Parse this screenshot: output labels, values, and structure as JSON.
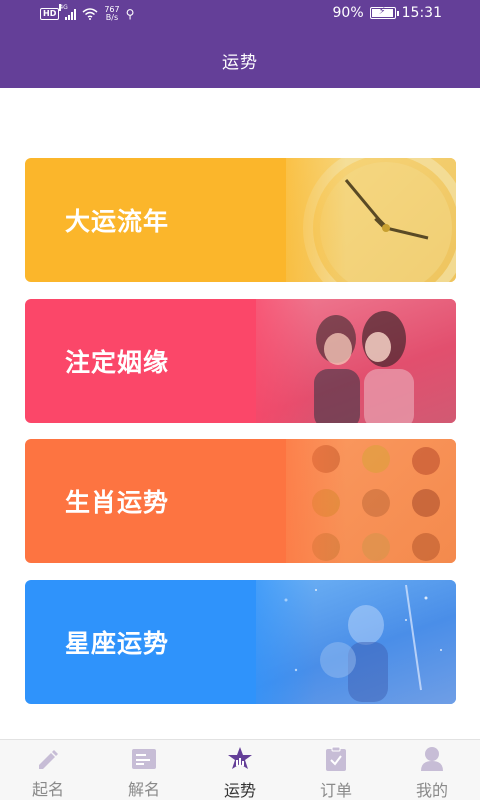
{
  "status_bar": {
    "hd": "HD",
    "network": "4G",
    "speed_top": "767",
    "speed_bottom": "B/s",
    "battery_percent": "90%",
    "battery_level": 0.9,
    "time": "15:31"
  },
  "header": {
    "title": "运势"
  },
  "cards": [
    {
      "label": "大运流年",
      "color": "#fbb62b",
      "art": "clock-image"
    },
    {
      "label": "注定姻缘",
      "color": "#fb4769",
      "art": "couple-image"
    },
    {
      "label": "生肖运势",
      "color": "#fd7441",
      "art": "zodiac-animals-image"
    },
    {
      "label": "星座运势",
      "color": "#2f93fb",
      "art": "constellation-image"
    }
  ],
  "bottom_nav": {
    "active_index": 2,
    "active_color": "#643f98",
    "inactive_color": "#c7bdd6",
    "items": [
      {
        "label": "起名",
        "icon": "pencil-icon"
      },
      {
        "label": "解名",
        "icon": "card-icon"
      },
      {
        "label": "运势",
        "icon": "star-chart-icon"
      },
      {
        "label": "订单",
        "icon": "clipboard-check-icon"
      },
      {
        "label": "我的",
        "icon": "person-icon"
      }
    ]
  }
}
